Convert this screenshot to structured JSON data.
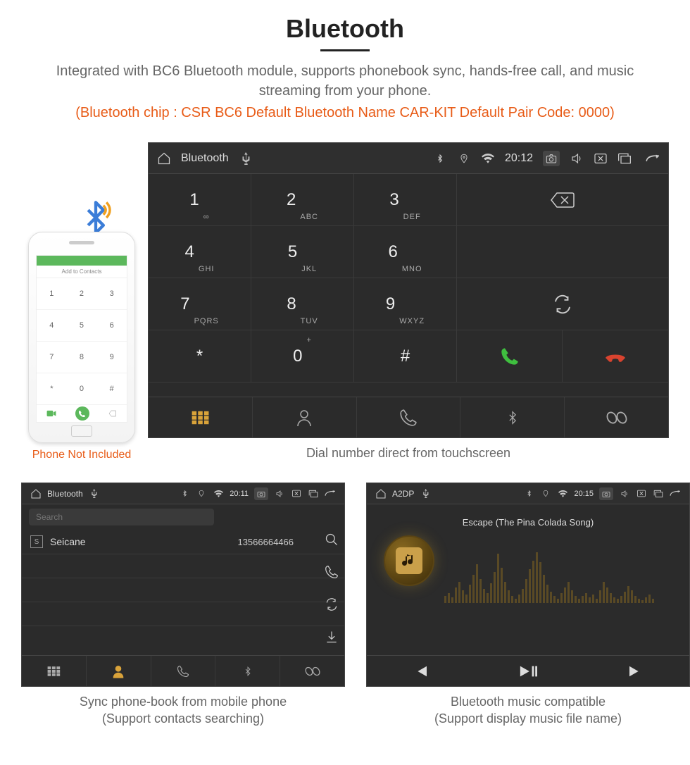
{
  "header": {
    "title": "Bluetooth",
    "subtitle": "Integrated with BC6 Bluetooth module, supports phonebook sync, hands-free call, and music streaming from your phone.",
    "spec": "(Bluetooth chip : CSR BC6    Default Bluetooth Name CAR-KIT    Default Pair Code: 0000)"
  },
  "phone": {
    "add_label": "Add to Contacts",
    "note": "Phone Not Included",
    "keys": [
      "1",
      "2",
      "3",
      "4",
      "5",
      "6",
      "7",
      "8",
      "9",
      "*",
      "0",
      "#"
    ]
  },
  "dialer": {
    "status": {
      "title": "Bluetooth",
      "time": "20:12"
    },
    "keys": [
      {
        "n": "1",
        "s": "∞"
      },
      {
        "n": "2",
        "s": "ABC"
      },
      {
        "n": "3",
        "s": "DEF"
      },
      {
        "n": "4",
        "s": "GHI"
      },
      {
        "n": "5",
        "s": "JKL"
      },
      {
        "n": "6",
        "s": "MNO"
      },
      {
        "n": "7",
        "s": "PQRS"
      },
      {
        "n": "8",
        "s": "TUV"
      },
      {
        "n": "9",
        "s": "WXYZ"
      },
      {
        "n": "*",
        "s": ""
      },
      {
        "n": "0",
        "s": "+"
      },
      {
        "n": "#",
        "s": ""
      }
    ],
    "caption": "Dial number direct from touchscreen"
  },
  "contacts": {
    "status": {
      "title": "Bluetooth",
      "time": "20:11"
    },
    "search_placeholder": "Search",
    "rows": [
      {
        "letter": "S",
        "name": "Seicane",
        "number": "13566664466"
      }
    ],
    "caption_l1": "Sync phone-book from mobile phone",
    "caption_l2": "(Support contacts searching)"
  },
  "music": {
    "status": {
      "title": "A2DP",
      "time": "20:15"
    },
    "track": "Escape (The Pina Colada Song)",
    "caption_l1": "Bluetooth music compatible",
    "caption_l2": "(Support display music file name)"
  }
}
